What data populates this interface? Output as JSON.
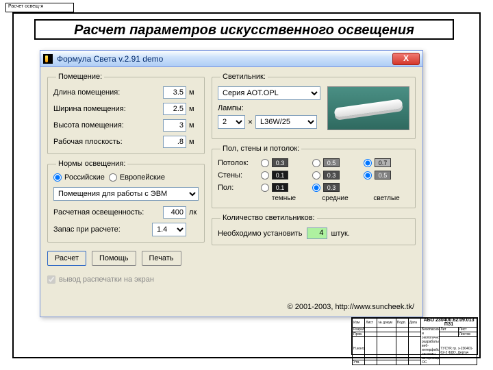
{
  "tag_text": "Расчет освещ-я",
  "page_title": "Расчет параметров искусственного освещения",
  "window": {
    "title": "Формула Света v.2.91 demo",
    "close": "X"
  },
  "room": {
    "legend": "Помещение:",
    "length_lbl": "Длина помещения:",
    "length_val": "3.5",
    "width_lbl": "Ширина помещения:",
    "width_val": "2.5",
    "height_lbl": "Высота помещения:",
    "height_val": "3",
    "work_lbl": "Рабочая плоскость:",
    "work_val": ".8",
    "unit": "м"
  },
  "norms": {
    "legend": "Нормы освещения:",
    "rus": "Российские",
    "eur": "Европейские",
    "room_type": "Помещения для работы с ЭВМ",
    "illum_lbl": "Расчетная освещенность:",
    "illum_val": "400",
    "illum_unit": "лк",
    "reserve_lbl": "Запас при расчете:",
    "reserve_val": "1.4"
  },
  "fixture": {
    "legend": "Светильник:",
    "series": "Серия AOT.OPL",
    "lamps_lbl": "Лампы:",
    "count": "2",
    "mult": "×",
    "lamp_type": "L36W/25"
  },
  "surfaces": {
    "legend": "Пол, стены и потолок:",
    "ceiling": "Потолок:",
    "walls": "Стены:",
    "floor": "Пол:",
    "v01": "0.1",
    "v03": "0.3",
    "v05": "0.5",
    "v07": "0.7",
    "dark": "темные",
    "mid": "средние",
    "light": "светлые"
  },
  "count": {
    "legend": "Количество светильников:",
    "need": "Необходимо установить",
    "value": "4",
    "units": "штук."
  },
  "buttons": {
    "calc": "Расчет",
    "help": "Помощь",
    "print": "Печать",
    "screen_out": "вывод распечатки на экран"
  },
  "copyright": "© 2001-2003, http://www.suncheek.tk/",
  "stamp": {
    "code": "АБО 230400.62.09.013 ПЗ1",
    "c1": "Изм",
    "c2": "Лист",
    "c3": "№ докум",
    "c4": "Подп.",
    "c5": "Дата",
    "r1": "Разраб.",
    "r2": "Пров.",
    "r3": "Н.контр.",
    "r4": "Утв.",
    "title": "Безопасность и экологичность разрабатываемого веб-интерфейса системы авторизации ОС",
    "lit": "Лит",
    "list": "Лист",
    "lists": "Листов",
    "org": "ТУСУР, гр. з-230401-62-2 ФДО, Дергач"
  }
}
